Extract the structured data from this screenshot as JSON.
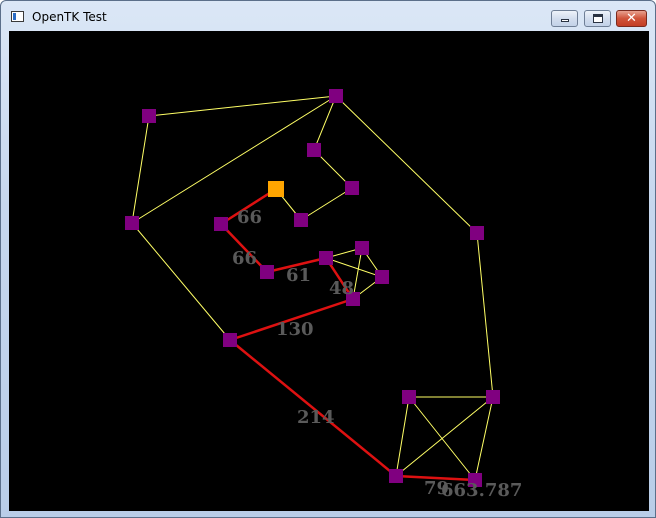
{
  "window": {
    "title": "OpenTK Test",
    "icons": {
      "app": "app-window-icon",
      "minimize": "minimize-icon",
      "maximize": "maximize-icon",
      "close": "close-icon"
    },
    "close_glyph": "✕"
  },
  "canvas": {
    "background": "#000000",
    "colors": {
      "node": "#800080",
      "start_node": "#ffa500",
      "graph_edge": "#ffff66",
      "path_edge": "#dd1111",
      "label": "#5a5a5a"
    },
    "edge_labels": [
      "66",
      "66",
      "61",
      "48",
      "130",
      "214",
      "79",
      "663.787"
    ]
  }
}
